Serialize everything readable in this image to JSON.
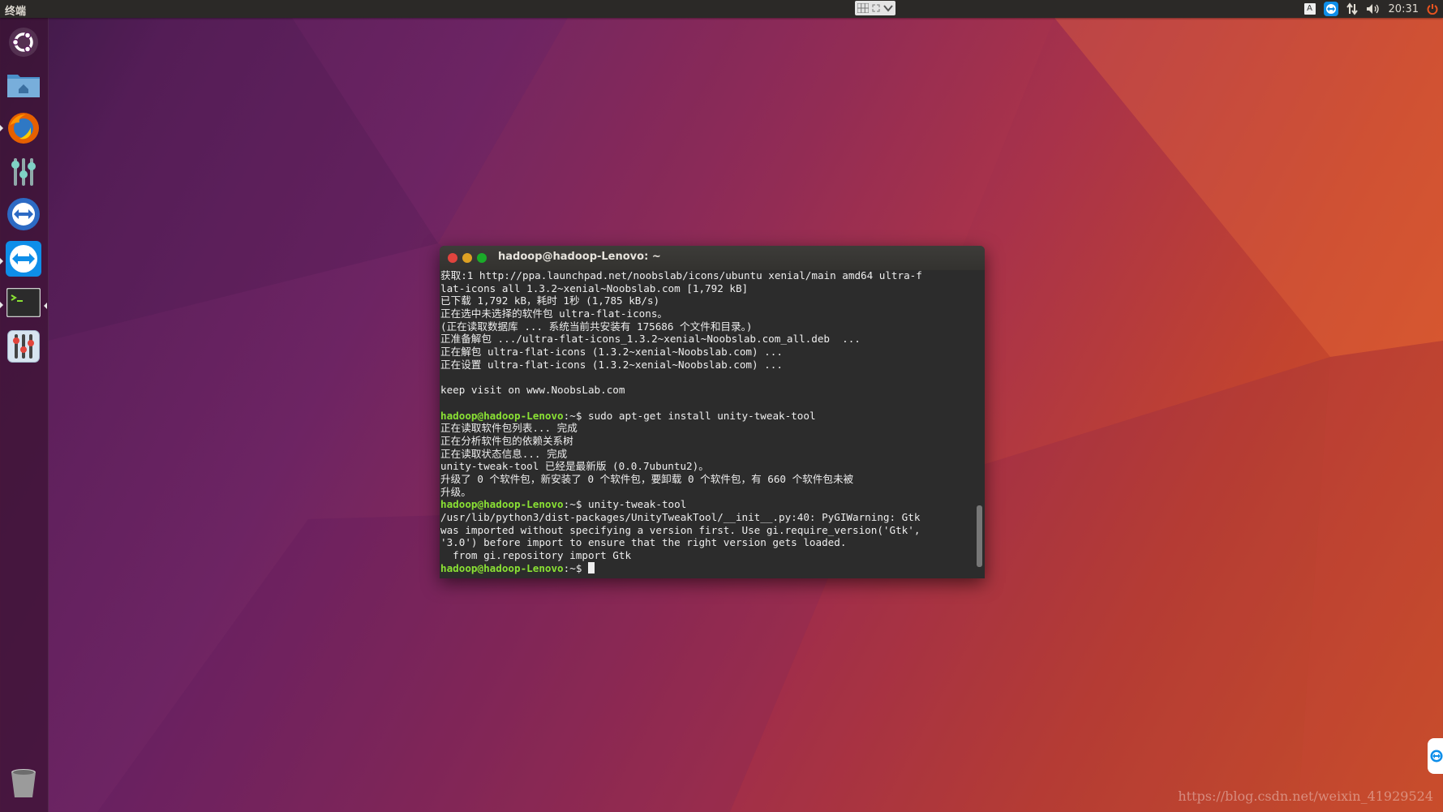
{
  "topbar": {
    "app_title": "终端",
    "keyboard_indicator": "A",
    "clock": "20:31"
  },
  "launcher": {
    "items": [
      {
        "id": "dash",
        "icon": "ubuntu-logo-icon"
      },
      {
        "id": "files",
        "icon": "home-folder-icon"
      },
      {
        "id": "firefox",
        "icon": "firefox-icon"
      },
      {
        "id": "system-settings",
        "icon": "sliders-icon"
      },
      {
        "id": "teamviewer-1",
        "icon": "teamviewer-icon"
      },
      {
        "id": "teamviewer-2",
        "icon": "teamviewer-icon"
      },
      {
        "id": "terminal",
        "icon": "terminal-icon"
      },
      {
        "id": "unity-tweak-tool",
        "icon": "tweak-tool-icon"
      },
      {
        "id": "trash",
        "icon": "trash-icon"
      }
    ]
  },
  "terminal": {
    "title": "hadoop@hadoop-Lenovo: ~",
    "prompt_user": "hadoop@hadoop-Lenovo",
    "prompt_suffix": ":~$",
    "lines": [
      {
        "text": "获取:1 http://ppa.launchpad.net/noobslab/icons/ubuntu xenial/main amd64 ultra-f"
      },
      {
        "text": "lat-icons all 1.3.2~xenial~Noobslab.com [1,792 kB]"
      },
      {
        "text": "已下载 1,792 kB，耗时 1秒 (1,785 kB/s)"
      },
      {
        "text": "正在选中未选择的软件包 ultra-flat-icons。"
      },
      {
        "text": "(正在读取数据库 ... 系统当前共安装有 175686 个文件和目录。)"
      },
      {
        "text": "正准备解包 .../ultra-flat-icons_1.3.2~xenial~Noobslab.com_all.deb  ..."
      },
      {
        "text": "正在解包 ultra-flat-icons (1.3.2~xenial~Noobslab.com) ..."
      },
      {
        "text": "正在设置 ultra-flat-icons (1.3.2~xenial~Noobslab.com) ..."
      },
      {
        "text": ""
      },
      {
        "text": "keep visit on www.NoobsLab.com"
      },
      {
        "text": ""
      },
      {
        "prompt": true,
        "text": " sudo apt-get install unity-tweak-tool"
      },
      {
        "text": "正在读取软件包列表... 完成"
      },
      {
        "text": "正在分析软件包的依赖关系树"
      },
      {
        "text": "正在读取状态信息... 完成"
      },
      {
        "text": "unity-tweak-tool 已经是最新版 (0.0.7ubuntu2)。"
      },
      {
        "text": "升级了 0 个软件包，新安装了 0 个软件包，要卸载 0 个软件包，有 660 个软件包未被"
      },
      {
        "text": "升级。"
      },
      {
        "prompt": true,
        "text": " unity-tweak-tool"
      },
      {
        "text": "/usr/lib/python3/dist-packages/UnityTweakTool/__init__.py:40: PyGIWarning: Gtk"
      },
      {
        "text": "was imported without specifying a version first. Use gi.require_version('Gtk',"
      },
      {
        "text": "'3.0') before import to ensure that the right version gets loaded."
      },
      {
        "text": "  from gi.repository import Gtk"
      },
      {
        "prompt": true,
        "text": " ",
        "cursor": true
      }
    ]
  },
  "watermark": "https://blog.csdn.net/weixin_41929524",
  "colors": {
    "prompt_green": "#8ae234",
    "close_red": "#e0443e",
    "minimize_yellow": "#dea123",
    "maximize_green": "#1aab29"
  }
}
